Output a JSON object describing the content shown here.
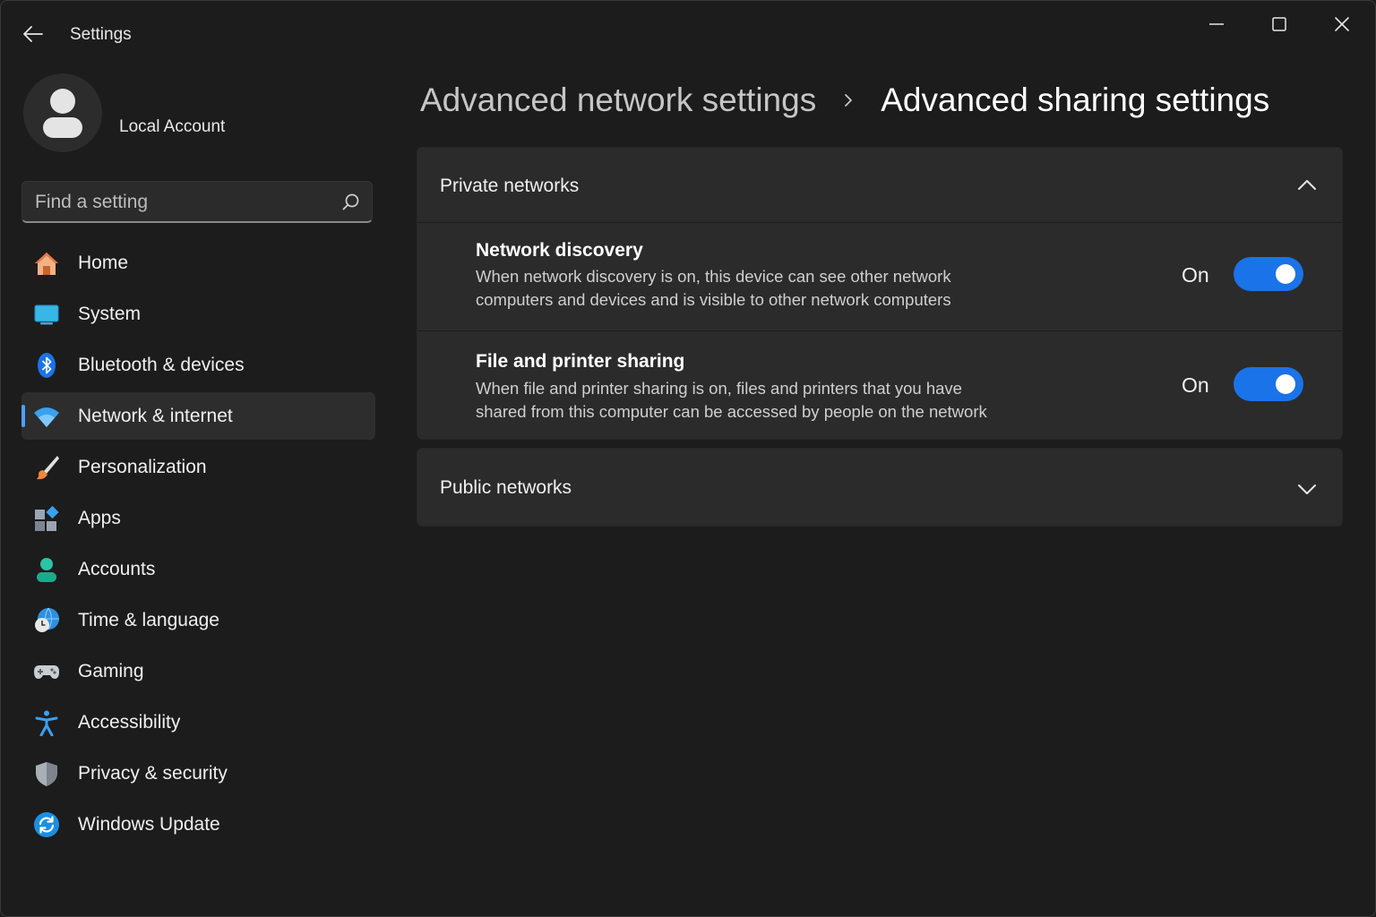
{
  "app": {
    "title": "Settings"
  },
  "account": {
    "name": "Local Account"
  },
  "search": {
    "placeholder": "Find a setting"
  },
  "sidebar": {
    "items": [
      {
        "label": "Home",
        "icon": "home-icon"
      },
      {
        "label": "System",
        "icon": "system-icon"
      },
      {
        "label": "Bluetooth & devices",
        "icon": "bluetooth-icon"
      },
      {
        "label": "Network & internet",
        "icon": "wifi-icon",
        "selected": true
      },
      {
        "label": "Personalization",
        "icon": "brush-icon"
      },
      {
        "label": "Apps",
        "icon": "apps-icon"
      },
      {
        "label": "Accounts",
        "icon": "account-icon"
      },
      {
        "label": "Time & language",
        "icon": "globe-clock-icon"
      },
      {
        "label": "Gaming",
        "icon": "gamepad-icon"
      },
      {
        "label": "Accessibility",
        "icon": "accessibility-icon"
      },
      {
        "label": "Privacy & security",
        "icon": "shield-icon"
      },
      {
        "label": "Windows Update",
        "icon": "update-icon"
      }
    ]
  },
  "header": {
    "parent": "Advanced network settings",
    "current": "Advanced sharing settings"
  },
  "private_networks": {
    "title": "Private networks",
    "expanded": true,
    "settings": [
      {
        "title": "Network discovery",
        "description_line1": "When network discovery is on, this device can see other network",
        "description_line2": "computers and devices and is visible to other network computers",
        "state": "On",
        "enabled": true
      },
      {
        "title": "File and printer sharing",
        "description_line1": "When file and printer sharing is on, files and printers that you have",
        "description_line2": "shared from this computer can be accessed by people on the network",
        "state": "On",
        "enabled": true
      }
    ]
  },
  "public_networks": {
    "title": "Public networks",
    "expanded": false
  },
  "colors": {
    "accent": "#1a73e8",
    "background": "#1c1c1c",
    "card": "#2b2b2b"
  }
}
